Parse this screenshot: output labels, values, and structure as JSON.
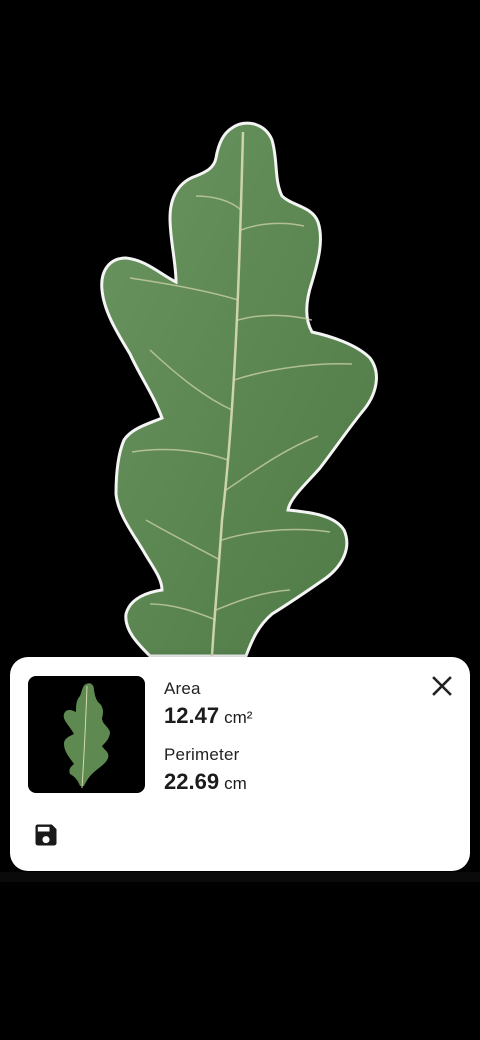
{
  "leaf_view": {
    "icon": "leaf-image"
  },
  "result_card": {
    "area": {
      "label": "Area",
      "value": "12.47",
      "unit": "cm²"
    },
    "perimeter": {
      "label": "Perimeter",
      "value": "22.69",
      "unit": "cm"
    },
    "icons": {
      "close": "close-icon",
      "save": "save-icon"
    }
  },
  "colors": {
    "background": "#000000",
    "card": "#ffffff",
    "leaf": "#5f8a55",
    "vein": "#d9dcb4",
    "text": "#1c1c1c"
  }
}
